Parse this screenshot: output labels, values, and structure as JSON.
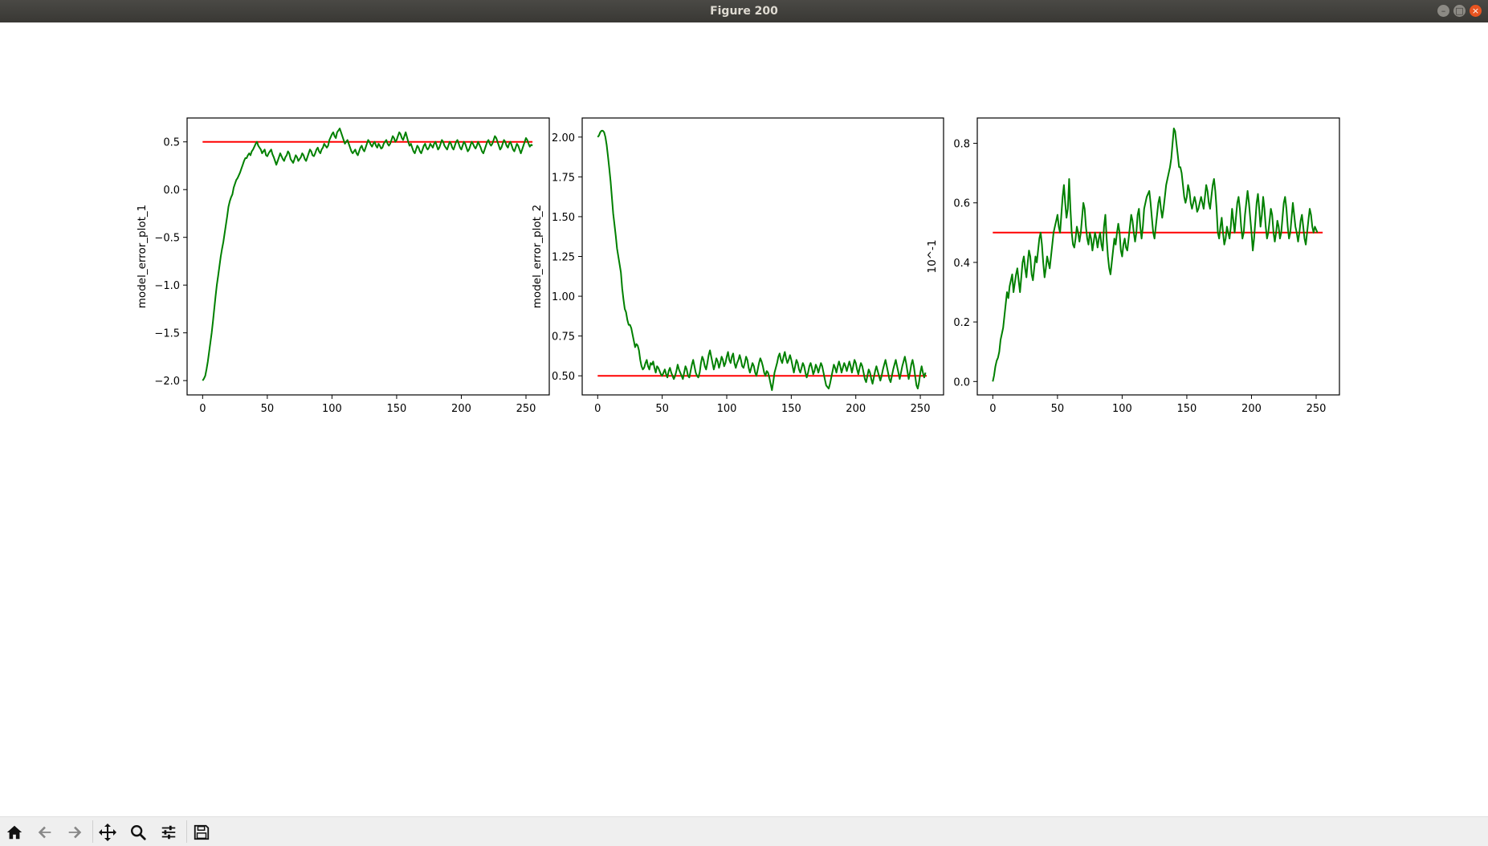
{
  "window": {
    "title": "Figure 200",
    "controls": {
      "minimize": "–",
      "maximize": "□",
      "close": "×"
    }
  },
  "colors": {
    "data_series": "#008000",
    "reference_line": "#ff0000",
    "axes": "#000000"
  },
  "toolbar": {
    "icons": [
      "home-icon",
      "back-arrow-icon",
      "forward-arrow-icon",
      "pan-move-icon",
      "zoom-magnifier-icon",
      "configure-subplots-icon",
      "save-floppy-icon"
    ]
  },
  "chart_data": [
    {
      "type": "line",
      "ylabel": "model_error_plot_1",
      "xlim": [
        -12,
        268
      ],
      "ylim": [
        -2.15,
        0.75
      ],
      "xticks": [
        0,
        50,
        100,
        150,
        200,
        250
      ],
      "yticks": [
        -2.0,
        -1.5,
        -1.0,
        -0.5,
        0.0,
        0.5
      ],
      "ytick_labels": [
        "−2.0",
        "−1.5",
        "−1.0",
        "−0.5",
        "0.0",
        "0.5"
      ],
      "x_start": 0,
      "x_step": 1,
      "series": [
        {
          "name": "",
          "color": "#008000",
          "values": [
            -2.0,
            -1.98,
            -1.95,
            -1.88,
            -1.8,
            -1.7,
            -1.6,
            -1.5,
            -1.38,
            -1.25,
            -1.12,
            -1.0,
            -0.9,
            -0.8,
            -0.7,
            -0.62,
            -0.55,
            -0.46,
            -0.37,
            -0.28,
            -0.18,
            -0.12,
            -0.08,
            -0.05,
            0.02,
            0.06,
            0.1,
            0.12,
            0.15,
            0.18,
            0.22,
            0.26,
            0.3,
            0.33,
            0.33,
            0.36,
            0.38,
            0.36,
            0.4,
            0.42,
            0.45,
            0.48,
            0.5,
            0.46,
            0.44,
            0.42,
            0.38,
            0.4,
            0.42,
            0.36,
            0.35,
            0.38,
            0.4,
            0.42,
            0.37,
            0.34,
            0.3,
            0.26,
            0.3,
            0.34,
            0.38,
            0.35,
            0.32,
            0.3,
            0.34,
            0.36,
            0.4,
            0.38,
            0.32,
            0.3,
            0.28,
            0.32,
            0.36,
            0.34,
            0.3,
            0.32,
            0.34,
            0.38,
            0.36,
            0.32,
            0.3,
            0.34,
            0.38,
            0.42,
            0.4,
            0.36,
            0.35,
            0.38,
            0.42,
            0.44,
            0.4,
            0.38,
            0.42,
            0.44,
            0.48,
            0.46,
            0.44,
            0.46,
            0.52,
            0.55,
            0.58,
            0.6,
            0.56,
            0.54,
            0.6,
            0.62,
            0.64,
            0.6,
            0.56,
            0.52,
            0.48,
            0.5,
            0.52,
            0.48,
            0.44,
            0.4,
            0.38,
            0.4,
            0.42,
            0.38,
            0.36,
            0.4,
            0.44,
            0.46,
            0.42,
            0.4,
            0.44,
            0.48,
            0.52,
            0.5,
            0.47,
            0.45,
            0.48,
            0.5,
            0.46,
            0.44,
            0.48,
            0.46,
            0.43,
            0.44,
            0.48,
            0.5,
            0.52,
            0.48,
            0.46,
            0.48,
            0.52,
            0.56,
            0.54,
            0.5,
            0.52,
            0.56,
            0.6,
            0.58,
            0.54,
            0.52,
            0.56,
            0.6,
            0.55,
            0.5,
            0.46,
            0.48,
            0.44,
            0.4,
            0.38,
            0.42,
            0.46,
            0.44,
            0.4,
            0.38,
            0.42,
            0.46,
            0.48,
            0.44,
            0.42,
            0.44,
            0.48,
            0.46,
            0.44,
            0.48,
            0.5,
            0.46,
            0.42,
            0.44,
            0.48,
            0.52,
            0.5,
            0.46,
            0.44,
            0.42,
            0.46,
            0.5,
            0.48,
            0.44,
            0.42,
            0.46,
            0.5,
            0.52,
            0.48,
            0.44,
            0.42,
            0.46,
            0.5,
            0.48,
            0.44,
            0.4,
            0.42,
            0.46,
            0.5,
            0.48,
            0.45,
            0.43,
            0.46,
            0.5,
            0.47,
            0.44,
            0.4,
            0.38,
            0.42,
            0.46,
            0.5,
            0.52,
            0.48,
            0.46,
            0.48,
            0.52,
            0.56,
            0.54,
            0.5,
            0.46,
            0.42,
            0.44,
            0.48,
            0.52,
            0.5,
            0.46,
            0.44,
            0.48,
            0.5,
            0.46,
            0.42,
            0.4,
            0.44,
            0.48,
            0.46,
            0.42,
            0.38,
            0.42,
            0.46,
            0.5,
            0.54,
            0.52,
            0.48,
            0.45,
            0.47,
            0.46
          ]
        },
        {
          "name": "",
          "color": "#ff0000",
          "x": [
            0,
            255
          ],
          "values": [
            0.5,
            0.5
          ]
        }
      ]
    },
    {
      "type": "line",
      "ylabel": "model_error_plot_2",
      "xlim": [
        -12,
        268
      ],
      "ylim": [
        0.38,
        2.12
      ],
      "xticks": [
        0,
        50,
        100,
        150,
        200,
        250
      ],
      "yticks": [
        0.5,
        0.75,
        1.0,
        1.25,
        1.5,
        1.75,
        2.0
      ],
      "ytick_labels": [
        "0.50",
        "0.75",
        "1.00",
        "1.25",
        "1.50",
        "1.75",
        "2.00"
      ],
      "x_start": 0,
      "x_step": 1,
      "series": [
        {
          "name": "",
          "color": "#008000",
          "values": [
            2.0,
            2.01,
            2.03,
            2.04,
            2.04,
            2.03,
            2.0,
            1.95,
            1.88,
            1.8,
            1.72,
            1.62,
            1.52,
            1.45,
            1.38,
            1.3,
            1.25,
            1.2,
            1.15,
            1.05,
            0.98,
            0.92,
            0.9,
            0.85,
            0.82,
            0.82,
            0.8,
            0.76,
            0.72,
            0.68,
            0.7,
            0.69,
            0.66,
            0.6,
            0.56,
            0.54,
            0.55,
            0.58,
            0.6,
            0.56,
            0.54,
            0.58,
            0.57,
            0.59,
            0.55,
            0.52,
            0.56,
            0.55,
            0.53,
            0.51,
            0.5,
            0.52,
            0.54,
            0.51,
            0.49,
            0.53,
            0.55,
            0.52,
            0.5,
            0.48,
            0.5,
            0.53,
            0.57,
            0.54,
            0.52,
            0.5,
            0.48,
            0.52,
            0.56,
            0.54,
            0.5,
            0.49,
            0.53,
            0.57,
            0.6,
            0.56,
            0.52,
            0.5,
            0.49,
            0.52,
            0.58,
            0.62,
            0.6,
            0.56,
            0.54,
            0.58,
            0.63,
            0.66,
            0.62,
            0.58,
            0.54,
            0.57,
            0.61,
            0.59,
            0.55,
            0.58,
            0.62,
            0.6,
            0.56,
            0.58,
            0.62,
            0.65,
            0.6,
            0.58,
            0.62,
            0.64,
            0.58,
            0.55,
            0.58,
            0.6,
            0.63,
            0.6,
            0.56,
            0.55,
            0.58,
            0.62,
            0.6,
            0.55,
            0.52,
            0.55,
            0.58,
            0.56,
            0.52,
            0.5,
            0.54,
            0.58,
            0.61,
            0.59,
            0.56,
            0.52,
            0.5,
            0.53,
            0.52,
            0.49,
            0.45,
            0.41,
            0.46,
            0.52,
            0.55,
            0.58,
            0.62,
            0.64,
            0.6,
            0.58,
            0.62,
            0.65,
            0.61,
            0.58,
            0.6,
            0.63,
            0.6,
            0.56,
            0.52,
            0.56,
            0.6,
            0.58,
            0.54,
            0.52,
            0.55,
            0.58,
            0.56,
            0.52,
            0.49,
            0.52,
            0.56,
            0.58,
            0.55,
            0.51,
            0.53,
            0.57,
            0.55,
            0.52,
            0.55,
            0.58,
            0.56,
            0.52,
            0.48,
            0.44,
            0.43,
            0.42,
            0.45,
            0.49,
            0.53,
            0.57,
            0.55,
            0.52,
            0.56,
            0.59,
            0.56,
            0.52,
            0.55,
            0.58,
            0.56,
            0.53,
            0.56,
            0.59,
            0.56,
            0.52,
            0.56,
            0.6,
            0.58,
            0.54,
            0.51,
            0.55,
            0.58,
            0.56,
            0.52,
            0.48,
            0.46,
            0.5,
            0.54,
            0.52,
            0.48,
            0.45,
            0.49,
            0.53,
            0.56,
            0.53,
            0.5,
            0.47,
            0.5,
            0.54,
            0.57,
            0.6,
            0.56,
            0.52,
            0.48,
            0.46,
            0.5,
            0.54,
            0.57,
            0.6,
            0.56,
            0.52,
            0.48,
            0.52,
            0.56,
            0.59,
            0.62,
            0.58,
            0.53,
            0.48,
            0.52,
            0.57,
            0.6,
            0.56,
            0.5,
            0.44,
            0.42,
            0.46,
            0.52,
            0.56,
            0.52,
            0.49,
            0.52
          ]
        },
        {
          "name": "",
          "color": "#ff0000",
          "x": [
            0,
            255
          ],
          "values": [
            0.5,
            0.5
          ]
        }
      ]
    },
    {
      "type": "line",
      "ylabel": "10^-1",
      "xlim": [
        -12,
        268
      ],
      "ylim": [
        -0.045,
        0.885
      ],
      "xticks": [
        0,
        50,
        100,
        150,
        200,
        250
      ],
      "yticks": [
        0.0,
        0.2,
        0.4,
        0.6,
        0.8
      ],
      "ytick_labels": [
        "0.0",
        "0.2",
        "0.4",
        "0.6",
        "0.8"
      ],
      "x_start": 0,
      "x_step": 1,
      "series": [
        {
          "name": "",
          "color": "#008000",
          "values": [
            0.0,
            0.02,
            0.05,
            0.07,
            0.08,
            0.1,
            0.14,
            0.16,
            0.18,
            0.22,
            0.26,
            0.3,
            0.28,
            0.32,
            0.34,
            0.36,
            0.3,
            0.33,
            0.36,
            0.38,
            0.34,
            0.3,
            0.35,
            0.4,
            0.42,
            0.38,
            0.35,
            0.4,
            0.44,
            0.42,
            0.36,
            0.34,
            0.38,
            0.42,
            0.4,
            0.44,
            0.48,
            0.5,
            0.46,
            0.4,
            0.35,
            0.38,
            0.42,
            0.4,
            0.38,
            0.42,
            0.46,
            0.5,
            0.52,
            0.54,
            0.56,
            0.52,
            0.5,
            0.56,
            0.62,
            0.66,
            0.6,
            0.55,
            0.58,
            0.68,
            0.58,
            0.5,
            0.46,
            0.45,
            0.48,
            0.52,
            0.5,
            0.47,
            0.5,
            0.55,
            0.6,
            0.58,
            0.52,
            0.48,
            0.46,
            0.5,
            0.48,
            0.44,
            0.47,
            0.5,
            0.48,
            0.45,
            0.48,
            0.5,
            0.46,
            0.44,
            0.52,
            0.56,
            0.48,
            0.42,
            0.38,
            0.36,
            0.4,
            0.44,
            0.48,
            0.46,
            0.5,
            0.53,
            0.5,
            0.44,
            0.42,
            0.46,
            0.48,
            0.45,
            0.44,
            0.48,
            0.52,
            0.56,
            0.54,
            0.5,
            0.47,
            0.5,
            0.56,
            0.58,
            0.52,
            0.48,
            0.52,
            0.58,
            0.6,
            0.62,
            0.63,
            0.64,
            0.6,
            0.55,
            0.5,
            0.48,
            0.52,
            0.56,
            0.6,
            0.62,
            0.58,
            0.55,
            0.58,
            0.62,
            0.66,
            0.68,
            0.7,
            0.72,
            0.75,
            0.8,
            0.85,
            0.84,
            0.8,
            0.76,
            0.72,
            0.72,
            0.7,
            0.66,
            0.62,
            0.6,
            0.62,
            0.66,
            0.64,
            0.6,
            0.58,
            0.6,
            0.62,
            0.6,
            0.57,
            0.58,
            0.6,
            0.62,
            0.6,
            0.58,
            0.62,
            0.66,
            0.64,
            0.6,
            0.58,
            0.62,
            0.66,
            0.68,
            0.64,
            0.58,
            0.5,
            0.48,
            0.52,
            0.55,
            0.5,
            0.46,
            0.48,
            0.52,
            0.5,
            0.48,
            0.52,
            0.58,
            0.54,
            0.5,
            0.55,
            0.6,
            0.62,
            0.58,
            0.52,
            0.48,
            0.5,
            0.56,
            0.6,
            0.64,
            0.6,
            0.55,
            0.5,
            0.44,
            0.48,
            0.54,
            0.6,
            0.63,
            0.58,
            0.52,
            0.56,
            0.62,
            0.58,
            0.52,
            0.48,
            0.5,
            0.54,
            0.58,
            0.56,
            0.5,
            0.47,
            0.5,
            0.54,
            0.52,
            0.48,
            0.5,
            0.55,
            0.6,
            0.62,
            0.58,
            0.52,
            0.48,
            0.5,
            0.55,
            0.6,
            0.56,
            0.52,
            0.5,
            0.47,
            0.5,
            0.54,
            0.56,
            0.52,
            0.48,
            0.46,
            0.5,
            0.54,
            0.58,
            0.56,
            0.52,
            0.5,
            0.52,
            0.51,
            0.5
          ]
        },
        {
          "name": "",
          "color": "#ff0000",
          "x": [
            0,
            255
          ],
          "values": [
            0.5,
            0.5
          ]
        }
      ]
    }
  ]
}
